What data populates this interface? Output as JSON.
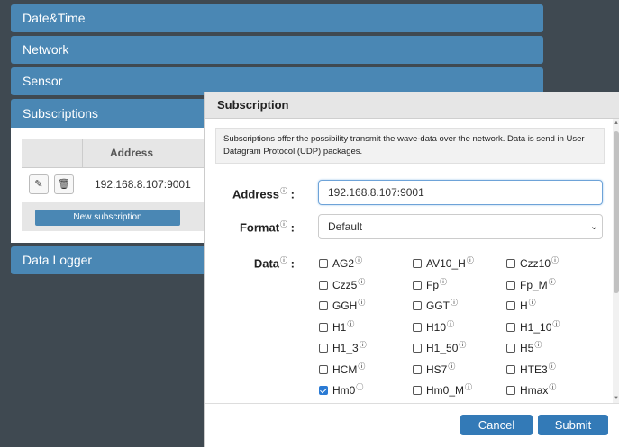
{
  "accordion": {
    "date_time": "Date&Time",
    "network": "Network",
    "sensor": "Sensor",
    "subscriptions": "Subscriptions",
    "data_logger": "Data Logger"
  },
  "subscriptions_table": {
    "address_header": "Address",
    "rows": [
      {
        "address": "192.168.8.107:9001"
      }
    ],
    "new_button": "New subscription"
  },
  "modal": {
    "title": "Subscription",
    "info": "Subscriptions offer the possibility transmit the wave-data over the network. Data is send in User Datagram Protocol (UDP) packages.",
    "address_label": "Address",
    "address_value": "192.168.8.107:9001",
    "format_label": "Format",
    "format_value": "Default",
    "data_label": "Data",
    "info_glyph": "ⓘ",
    "colon": ":",
    "checkboxes": [
      {
        "label": "AG2",
        "checked": false
      },
      {
        "label": "AV10_H",
        "checked": false
      },
      {
        "label": "Czz10",
        "checked": false
      },
      {
        "label": "Czz5",
        "checked": false
      },
      {
        "label": "Fp",
        "checked": false
      },
      {
        "label": "Fp_M",
        "checked": false
      },
      {
        "label": "GGH",
        "checked": false
      },
      {
        "label": "GGT",
        "checked": false
      },
      {
        "label": "H",
        "checked": false
      },
      {
        "label": "H1",
        "checked": false
      },
      {
        "label": "H10",
        "checked": false
      },
      {
        "label": "H1_10",
        "checked": false
      },
      {
        "label": "H1_3",
        "checked": false
      },
      {
        "label": "H1_50",
        "checked": false
      },
      {
        "label": "H5",
        "checked": false
      },
      {
        "label": "HCM",
        "checked": false
      },
      {
        "label": "HS7",
        "checked": false
      },
      {
        "label": "HTE3",
        "checked": false
      },
      {
        "label": "Hm0",
        "checked": true
      },
      {
        "label": "Hm0_M",
        "checked": false
      },
      {
        "label": "Hmax",
        "checked": false
      }
    ],
    "cancel": "Cancel",
    "submit": "Submit"
  }
}
